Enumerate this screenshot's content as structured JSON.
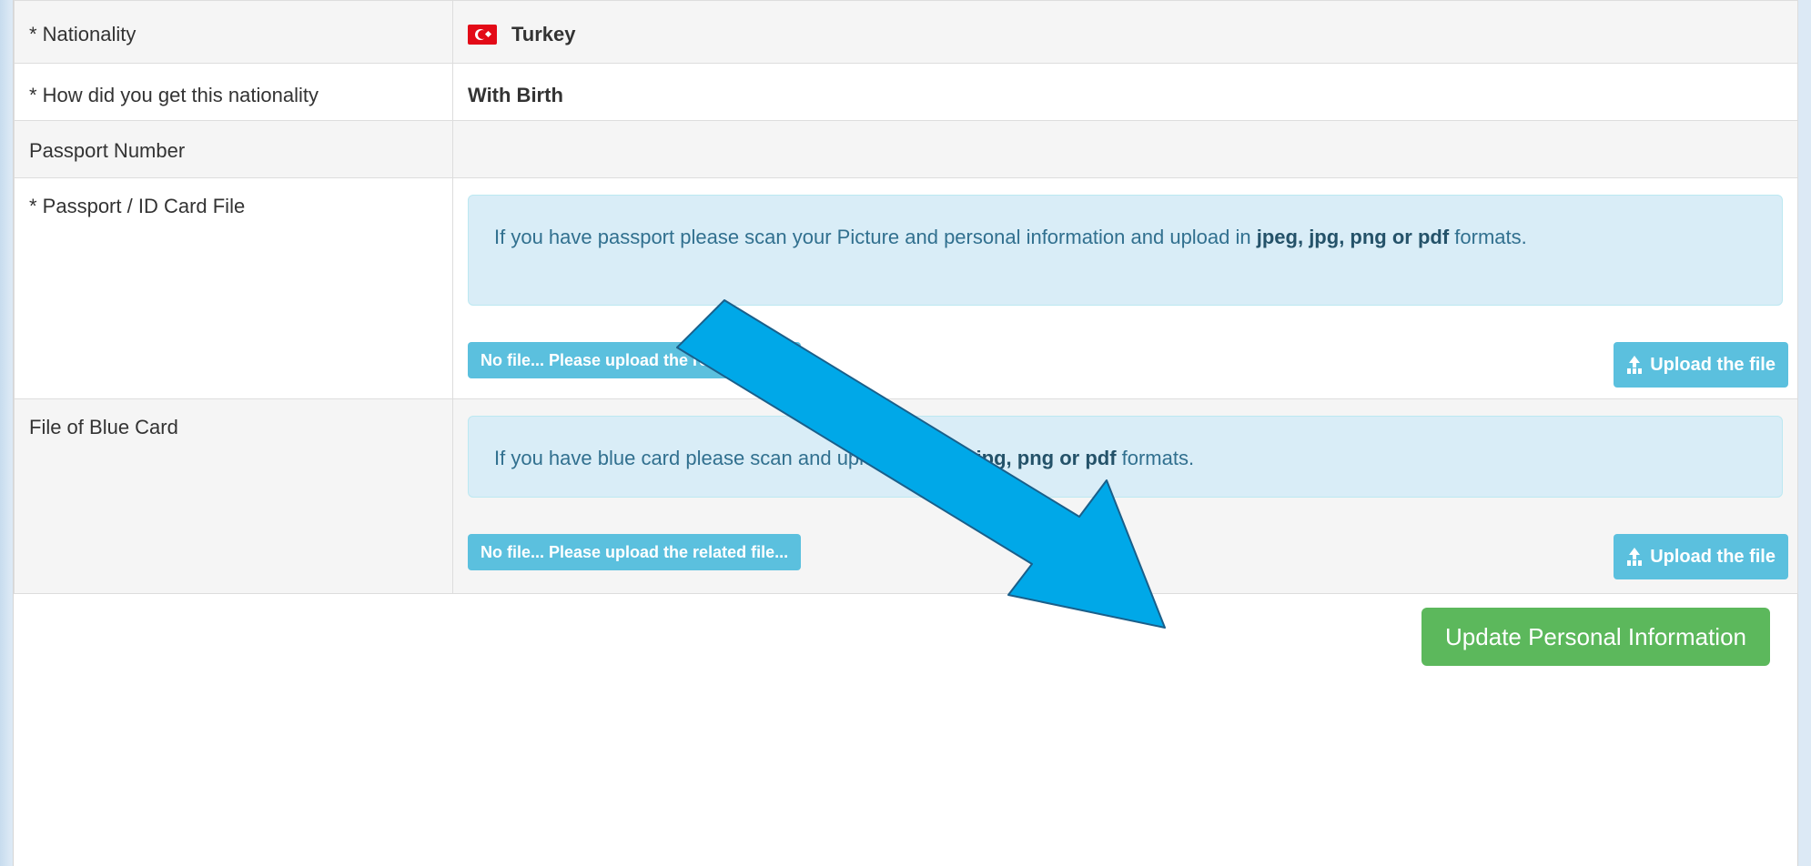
{
  "rows": {
    "nationality": {
      "label": "* Nationality",
      "value": "Turkey",
      "flag_icon": "turkey-flag-icon"
    },
    "how_obtained": {
      "label": "* How did you get this nationality",
      "value": "With Birth"
    },
    "passport_number": {
      "label": "Passport Number",
      "value": ""
    },
    "passport_file": {
      "label": "* Passport / ID Card File",
      "info_text_before": "If you have passport please scan your Picture and personal information and upload in ",
      "info_formats_bold": "jpeg, jpg, png or pdf",
      "info_text_after": " formats.",
      "file_status": "No file... Please upload the related file...",
      "upload_button": "Upload the file"
    },
    "blue_card_file": {
      "label": "File of Blue Card",
      "info_text_before": "If you have blue card please scan and upload in ",
      "info_formats_bold": "jpeg, jpg, png or pdf",
      "info_text_after": " formats.",
      "file_status": "No file... Please upload the related file...",
      "upload_button": "Upload the file"
    }
  },
  "actions": {
    "update_button": "Update Personal Information"
  },
  "colors": {
    "info": "#5bc0de",
    "success": "#5cb85c",
    "alert_bg": "#d9edf7",
    "annotation_arrow": "#00a8e8"
  }
}
